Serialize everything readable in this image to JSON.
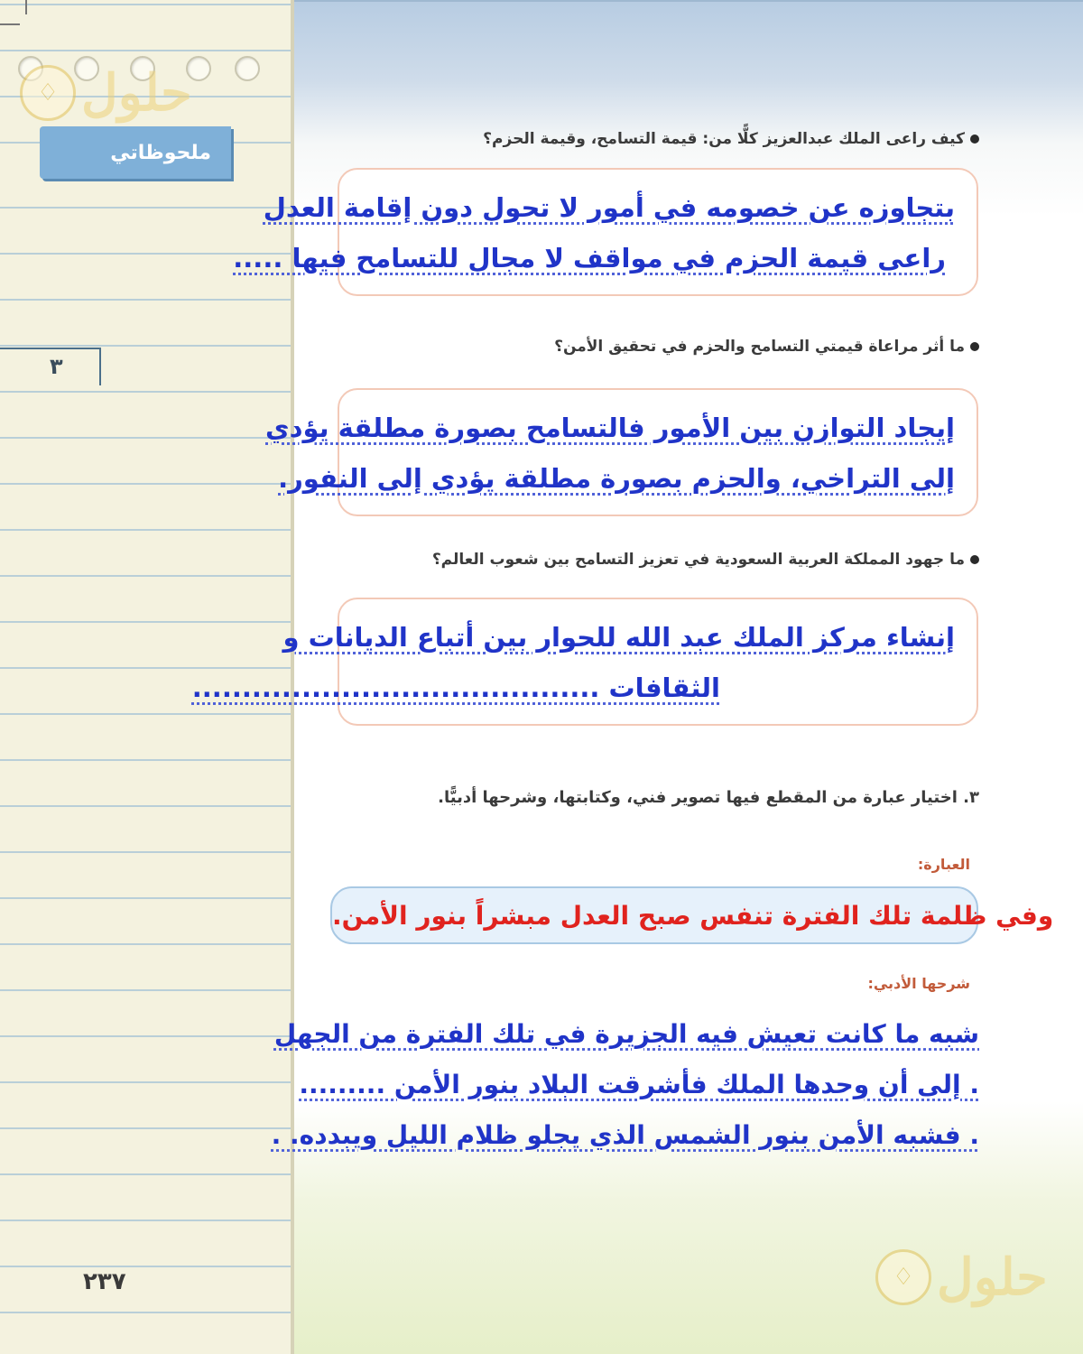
{
  "sidebar": {
    "notes_tab": "ملحوظاتي",
    "chapter_number": "٣",
    "page_number": "٢٣٧"
  },
  "watermark": {
    "brand": "حلول",
    "icon": "book-badge-icon"
  },
  "questions": [
    {
      "text": "كيف راعى الملك عبدالعزيز كلًّا من: قيمة التسامح، وقيمة الحزم؟",
      "answer_lines": [
        "بتجاوزه عن خصومه في أمور لا تحول دون إقامة العدل",
        "راعى قيمة الحزم في مواقف لا مجال للتسامح فيها ....."
      ]
    },
    {
      "text": "ما أثر مراعاة قيمتي التسامح والحزم في تحقيق الأمن؟",
      "answer_lines": [
        "إيجاد التوازن بين الأمور فالتسامح بصورة مطلقة يؤدي",
        "إلى التراخي، والحزم بصورة مطلقة يؤدي إلى النفور."
      ]
    },
    {
      "text": "ما جهود المملكة العربية السعودية في تعزيز التسامح بين شعوب العالم؟",
      "answer_lines": [
        "إنشاء مركز الملك عبد الله للحوار بين أتباع الديانات و",
        "الثقافات ........................................."
      ]
    }
  ],
  "section3": {
    "heading": "٣. اختيار عبارة من المقطع فيها تصوير فني، وكتابتها، وشرحها أدبيًّا.",
    "phrase_label": "العبارة:",
    "phrase": "وفي ظلمة تلك الفترة تنفس صبح العدل مبشراً بنور الأمن.",
    "explanation_label": "شرحها الأدبي:",
    "explanation_lines": [
      "شبه ما كانت تعيش فيه الجزيرة في تلك الفترة من الجهل",
      ". إلى أن وحدها الملك فأشرقت البلاد بنور الأمن .........",
      ". فشبه الأمن بنور الشمس الذي يجلو ظلام الليل ويبدده. ."
    ]
  }
}
